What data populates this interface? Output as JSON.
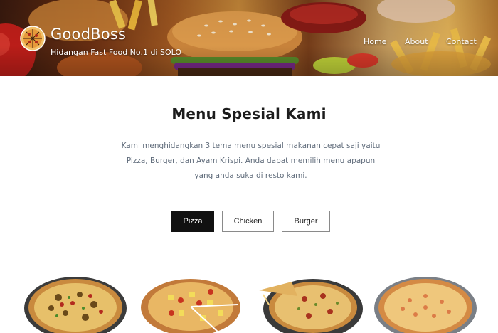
{
  "brand": {
    "name": "GoodBoss",
    "tagline": "Hidangan Fast Food No.1 di SOLO",
    "logo_icon": "pizza-logo-icon"
  },
  "nav": {
    "items": [
      {
        "label": "Home"
      },
      {
        "label": "About"
      },
      {
        "label": "Contact"
      }
    ]
  },
  "menu": {
    "title": "Menu Spesial Kami",
    "description": "Kami menghidangkan 3 tema menu spesial makanan cepat saji yaitu Pizza, Burger, dan Ayam Krispi. Anda dapat memilih menu apapun yang anda suka di resto kami.",
    "filters": [
      {
        "label": "Pizza",
        "active": true
      },
      {
        "label": "Chicken",
        "active": false
      },
      {
        "label": "Burger",
        "active": false
      }
    ]
  },
  "colors": {
    "active_filter_bg": "#111111",
    "active_filter_text": "#ffffff",
    "filter_border": "#8a8a8a",
    "description_text": "#5f6b7a"
  }
}
